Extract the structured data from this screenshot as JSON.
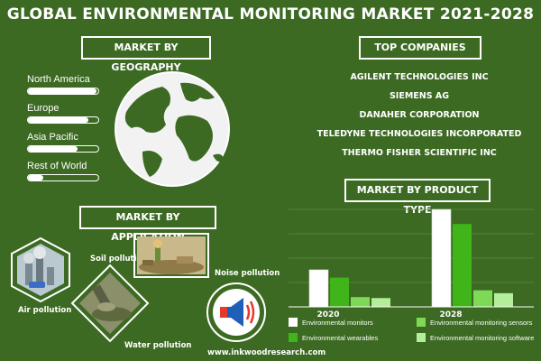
{
  "title": "GLOBAL ENVIRONMENTAL MONITORING MARKET 2021-2028",
  "geography": {
    "label": "MARKET BY GEOGRAPHY",
    "items": [
      {
        "name": "North America",
        "share": 0.98
      },
      {
        "name": "Europe",
        "share": 0.86
      },
      {
        "name": "Asia Pacific",
        "share": 0.7
      },
      {
        "name": "Rest of World",
        "share": 0.22
      }
    ]
  },
  "companies": {
    "label": "TOP COMPANIES",
    "list": [
      "AGILENT TECHNOLOGIES INC",
      "SIEMENS AG",
      "DANAHER CORPORATION",
      "TELEDYNE TECHNOLOGIES INCORPORATED",
      "THERMO FISHER SCIENTIFIC INC"
    ]
  },
  "application": {
    "label": "MARKET BY APPLICATION",
    "items": [
      "Soil pollution",
      "Air pollution",
      "Noise pollution",
      "Water pollution"
    ]
  },
  "website": "www.inkwoodresearch.com",
  "chart_data": {
    "type": "bar",
    "title": "MARKET BY PRODUCT TYPE",
    "categories": [
      "2020",
      "2028"
    ],
    "series": [
      {
        "name": "Environmental monitors",
        "color": "#ffffff",
        "values": [
          38,
          100
        ]
      },
      {
        "name": "Environmental wearables",
        "color": "#3fb51a",
        "values": [
          30,
          85
        ]
      },
      {
        "name": "Environmental monitoring sensors",
        "color": "#7ed957",
        "values": [
          10,
          17
        ]
      },
      {
        "name": "Environmental monitoring software",
        "color": "#b4ee9a",
        "values": [
          9,
          14
        ]
      }
    ],
    "ylim": [
      0,
      100
    ],
    "grid": true,
    "legend_position": "bottom"
  }
}
